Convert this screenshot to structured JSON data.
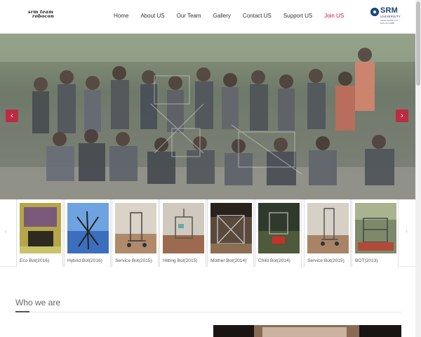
{
  "header": {
    "logo_text_line1": "srm team",
    "logo_text_line2": "robocon",
    "nav": [
      {
        "label": "Home"
      },
      {
        "label": "About US"
      },
      {
        "label": "Our Team"
      },
      {
        "label": "Gallery"
      },
      {
        "label": "Contact US"
      },
      {
        "label": "Support US"
      },
      {
        "label": "Join US"
      }
    ],
    "university": {
      "name": "SRM",
      "sub": "UNIVERSITY",
      "tagline": "(under section 3 of UGC Act 1956)"
    },
    "join_color": "#c0183c"
  },
  "hero": {
    "prev_icon": "chevron-left-icon",
    "next_icon": "chevron-right-icon",
    "prev_glyph": "‹",
    "next_glyph": "›",
    "accent_color": "#c81e3c"
  },
  "carousel": {
    "prev_glyph": "‹",
    "next_glyph": "›",
    "items": [
      {
        "caption": "Eco Bot(2016)"
      },
      {
        "caption": "Hybrid Bot(2016)"
      },
      {
        "caption": "Service Bot(2015)"
      },
      {
        "caption": "Hitting Bot(2015)"
      },
      {
        "caption": "Mother Bot(2014)"
      },
      {
        "caption": "Child Bot(2014)"
      },
      {
        "caption": "Service Bot(2015)"
      },
      {
        "caption": "BOT(2013)"
      }
    ]
  },
  "section": {
    "title": "Who we are"
  }
}
